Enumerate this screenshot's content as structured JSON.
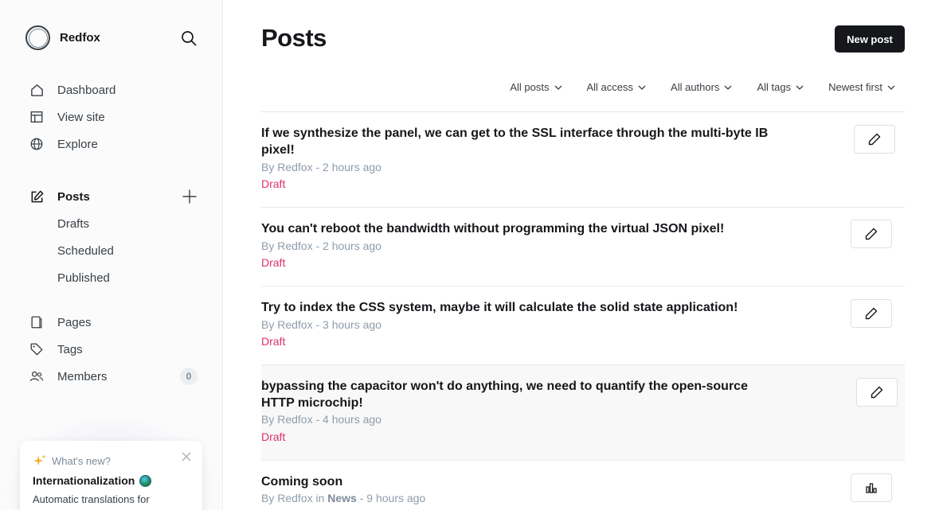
{
  "sidebar": {
    "brand": "Redfox",
    "nav_main": [
      {
        "label": "Dashboard",
        "icon": "house-icon"
      },
      {
        "label": "View site",
        "icon": "layout-icon"
      },
      {
        "label": "Explore",
        "icon": "globe-icon"
      }
    ],
    "posts": {
      "label": "Posts",
      "sub": [
        "Drafts",
        "Scheduled",
        "Published"
      ]
    },
    "nav_bottom": [
      {
        "label": "Pages",
        "icon": "pages-icon"
      },
      {
        "label": "Tags",
        "icon": "tag-icon"
      },
      {
        "label": "Members",
        "icon": "members-icon",
        "count": "0"
      }
    ],
    "whats_new": {
      "heading": "What's new?",
      "title": "Internationalization",
      "text": "Automatic translations for"
    }
  },
  "main": {
    "title": "Posts",
    "new_post_label": "New post",
    "filters": [
      "All posts",
      "All access",
      "All authors",
      "All tags",
      "Newest first"
    ],
    "posts": [
      {
        "title": "If we synthesize the panel, we can get to the SSL interface through the multi-byte IB pixel!",
        "meta": "By Redfox - 2 hours ago",
        "status": "Draft"
      },
      {
        "title": "You can't reboot the bandwidth without programming the virtual JSON pixel!",
        "meta": "By Redfox - 2 hours ago",
        "status": "Draft"
      },
      {
        "title": "Try to index the CSS system, maybe it will calculate the solid state application!",
        "meta": "By Redfox - 3 hours ago",
        "status": "Draft"
      },
      {
        "title": "bypassing the capacitor won't do anything, we need to quantify the open-source HTTP microchip!",
        "meta": "By Redfox - 4 hours ago",
        "status": "Draft"
      },
      {
        "title": "Coming soon",
        "meta_prefix": "By Redfox in",
        "meta_tag": "News",
        "meta_suffix": "- 9 hours ago"
      }
    ]
  },
  "colors": {
    "accent": "#15171a",
    "draft": "#e0306f",
    "muted": "#8e9cac"
  }
}
